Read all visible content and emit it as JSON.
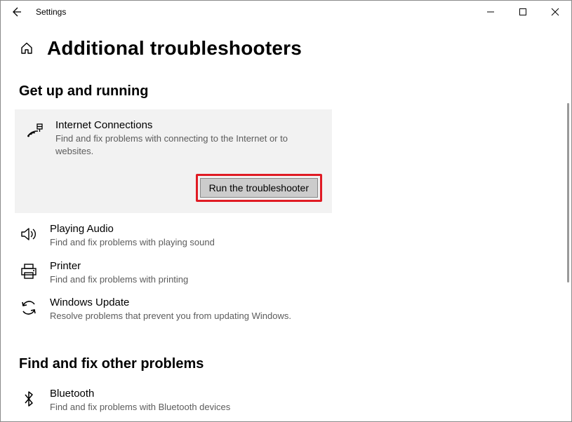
{
  "window": {
    "title": "Settings"
  },
  "page": {
    "heading": "Additional troubleshooters"
  },
  "sections": {
    "getUp": {
      "title": "Get up and running",
      "items": {
        "internet": {
          "name": "Internet Connections",
          "desc": "Find and fix problems with connecting to the Internet or to websites.",
          "run_label": "Run the troubleshooter"
        },
        "audio": {
          "name": "Playing Audio",
          "desc": "Find and fix problems with playing sound"
        },
        "printer": {
          "name": "Printer",
          "desc": "Find and fix problems with printing"
        },
        "update": {
          "name": "Windows Update",
          "desc": "Resolve problems that prevent you from updating Windows."
        }
      }
    },
    "other": {
      "title": "Find and fix other problems",
      "items": {
        "bluetooth": {
          "name": "Bluetooth",
          "desc": "Find and fix problems with Bluetooth devices"
        }
      }
    }
  }
}
